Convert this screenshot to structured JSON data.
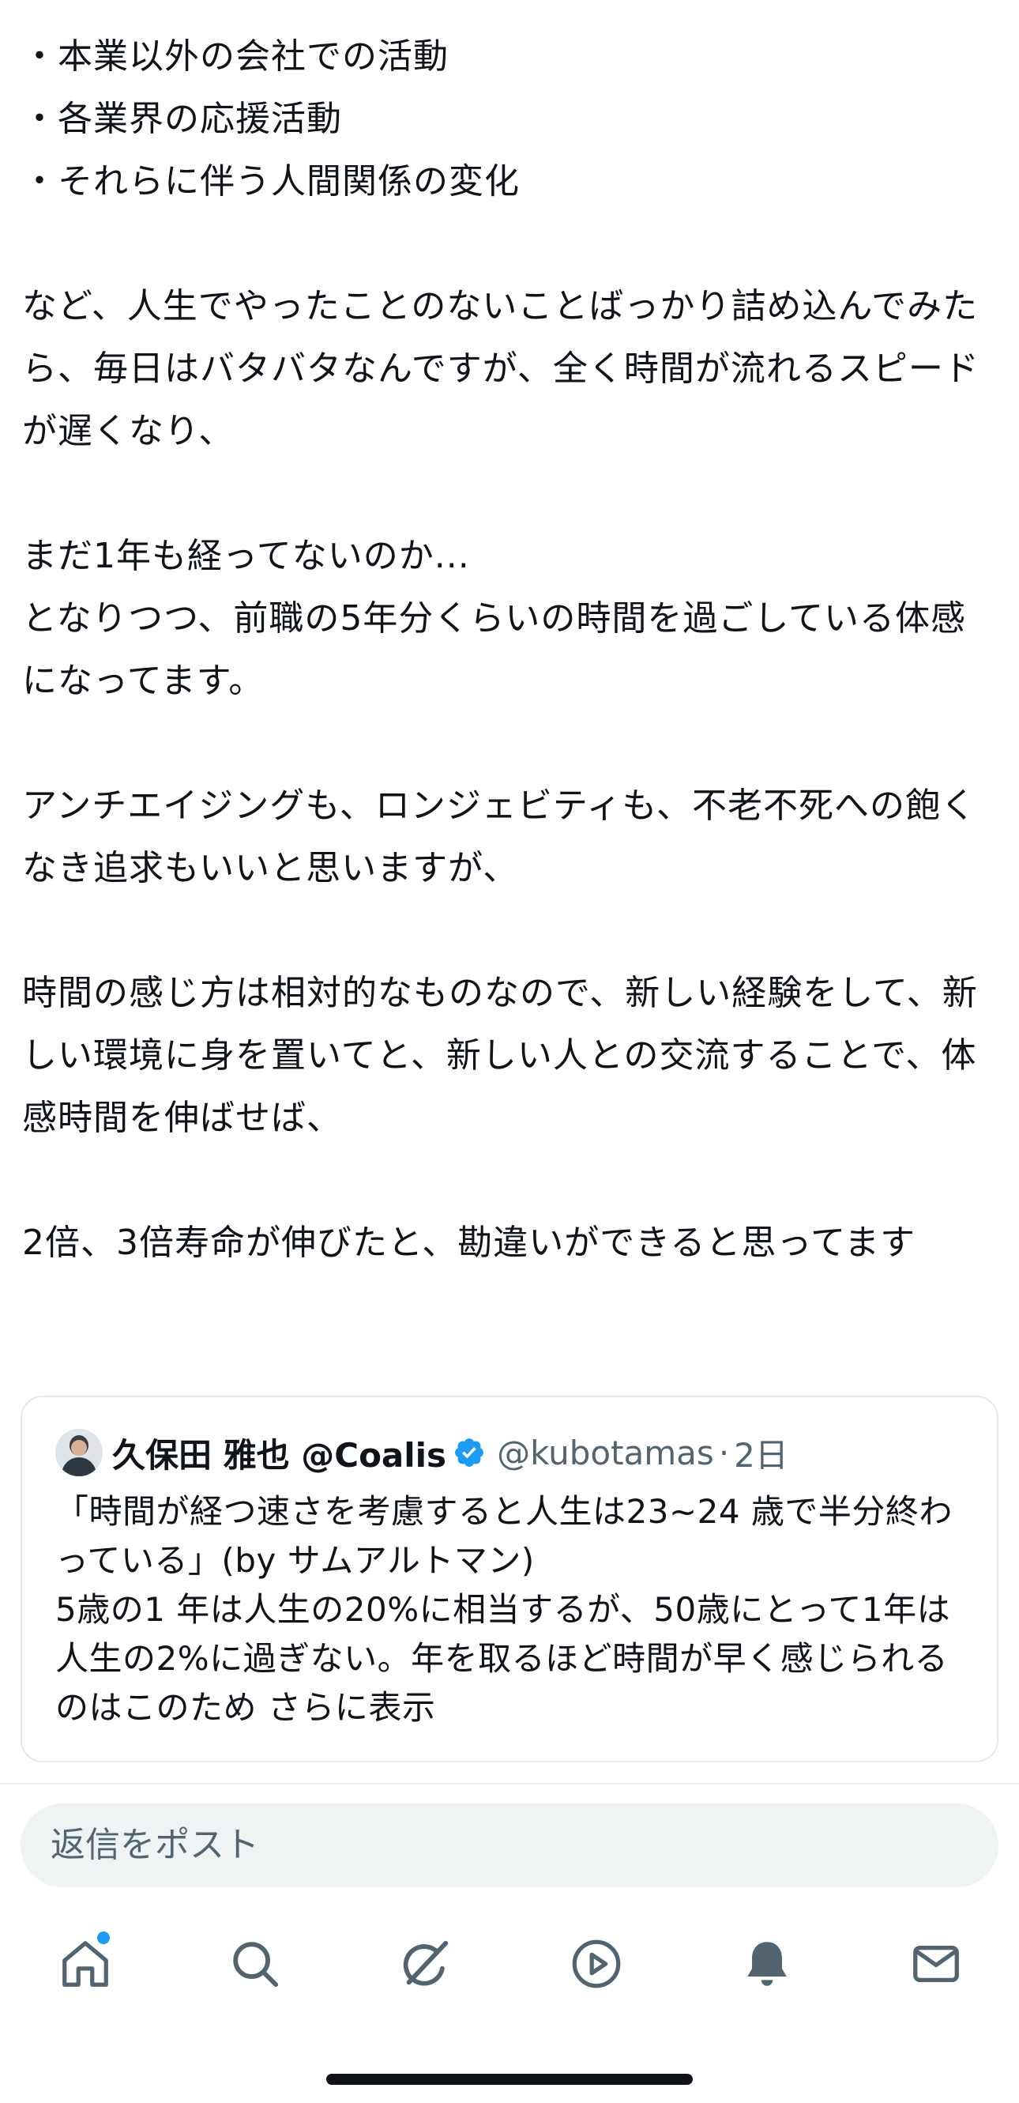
{
  "post": {
    "lines": [
      "・本業以外の会社での活動",
      "・各業界の応援活動",
      "・それらに伴う人間関係の変化",
      "",
      "など、人生でやったことのないことばっかり詰め込んでみたら、毎日はバタバタなんですが、全く時間が流れるスピードが遅くなり、",
      "",
      "まだ1年も経ってないのか...",
      "となりつつ、前職の5年分くらいの時間を過ごしている体感になってます。",
      "",
      "アンチエイジングも、ロンジェビティも、不老不死への飽くなき追求もいいと思いますが、",
      "",
      "時間の感じ方は相対的なものなので、新しい経験をして、新しい環境に身を置いてと、新しい人との交流することで、体感時間を伸ばせば、",
      "",
      "2倍、3倍寿命が伸びたと、勘違いができると思ってます"
    ]
  },
  "quote": {
    "name": "久保田 雅也 @Coalis",
    "handle": "@kubotamas",
    "separator": "·",
    "time": "2日",
    "text": "「時間が経つ速さを考慮すると人生は23~24 歳で半分終わっている」(by サムアルトマン)\n5歳の1 年は人生の20%に相当するが、50歳にとって1年は人生の2%に過ぎない。年を取るほど時間が早く感じられるのはこのため",
    "more_label": "さらに表示",
    "verified_color": "#1d9bf0"
  },
  "reply": {
    "placeholder": "返信をポスト"
  },
  "tabbar": {
    "items": [
      {
        "icon": "home-icon",
        "active": true,
        "has_notification_dot": true
      },
      {
        "icon": "search-icon"
      },
      {
        "icon": "grok-icon"
      },
      {
        "icon": "video-play-icon"
      },
      {
        "icon": "notifications-bell-icon"
      },
      {
        "icon": "messages-envelope-icon"
      }
    ]
  },
  "colors": {
    "accent": "#1d9bf0",
    "text": "#0f1419",
    "secondary": "#536471"
  }
}
